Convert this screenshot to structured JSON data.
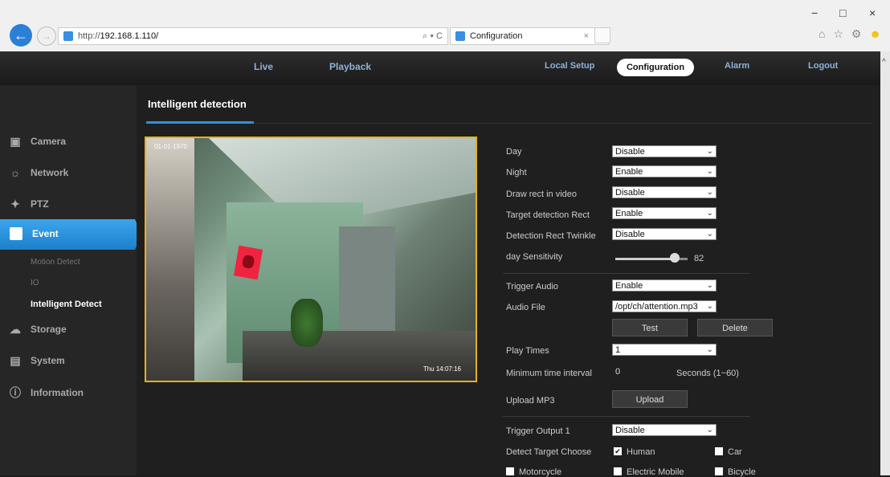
{
  "browser": {
    "url_prefix": "http://",
    "url_host": "192.168.1.110/",
    "url_tools": "⌕ ▾ C",
    "tab_title": "Configuration",
    "tab_close": "×",
    "win_min": "−",
    "win_max": "□",
    "win_close": "×",
    "right_icons": "⌂ ☆ ⚙",
    "smiley": "☻",
    "back": "←",
    "forward": "→"
  },
  "nav": {
    "live": "Live",
    "playback": "Playback",
    "local_setup": "Local Setup",
    "configuration": "Configuration",
    "alarm": "Alarm",
    "logout": "Logout"
  },
  "sidebar": {
    "camera": "Camera",
    "network": "Network",
    "ptz": "PTZ",
    "event": "Event",
    "motion_detect": "Motion Detect",
    "io": "IO",
    "intelligent_detect": "Intelligent Detect",
    "storage": "Storage",
    "system": "System",
    "information": "Information"
  },
  "page": {
    "title": "Intelligent detection"
  },
  "form": {
    "day_label": "Day",
    "day_value": "Disable",
    "night_label": "Night",
    "night_value": "Enable",
    "draw_rect_label": "Draw rect in video",
    "draw_rect_value": "Disable",
    "target_rect_label": "Target detection Rect",
    "target_rect_value": "Enable",
    "twinkle_label": "Detection Rect Twinkle",
    "twinkle_value": "Disable",
    "sensitivity_label": "day Sensitivity",
    "sensitivity_value": 82,
    "sensitivity_text": "82",
    "trigger_audio_label": "Trigger Audio",
    "trigger_audio_value": "Enable",
    "audio_file_label": "Audio File",
    "audio_file_value": "/opt/ch/attention.mp3",
    "test_button": "Test",
    "delete_button": "Delete",
    "play_times_label": "Play Times",
    "play_times_value": "1",
    "min_interval_label": "Minimum time interval",
    "min_interval_value": "0",
    "min_interval_unit": "Seconds (1~60)",
    "upload_mp3_label": "Upload MP3",
    "upload_button": "Upload",
    "trigger_output_label": "Trigger Output 1",
    "trigger_output_value": "Disable",
    "detect_target_label": "Detect Target Choose",
    "human_label": "Human",
    "car_label": "Car",
    "motorcycle_label": "Motorcycle",
    "electric_mobile_label": "Electric Mobile",
    "bicycle_label": "Bicycle",
    "check_mark": "✔"
  },
  "video": {
    "osd_top": "01-01-1970",
    "osd_bottom": "Thu 14:07:16"
  },
  "colors": {
    "accent": "#2f8fe2",
    "video_border": "#e8b020",
    "nav_text": "#8fb2d8"
  }
}
